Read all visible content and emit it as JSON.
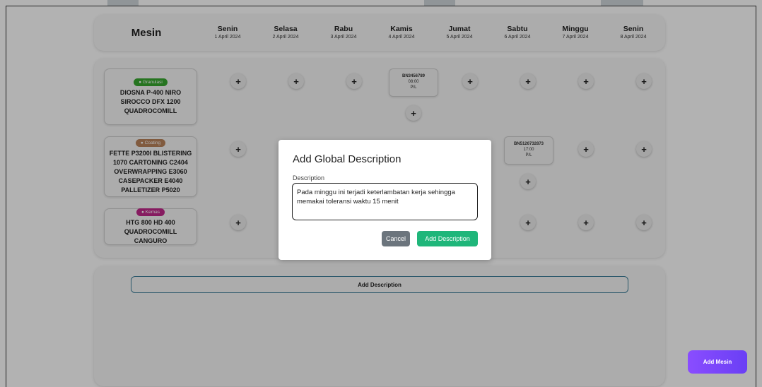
{
  "header": {
    "mesin_label": "Mesin",
    "days": [
      {
        "name": "Senin",
        "date": "1 April 2024"
      },
      {
        "name": "Selasa",
        "date": "2 April 2024"
      },
      {
        "name": "Rabu",
        "date": "3 April 2024"
      },
      {
        "name": "Kamis",
        "date": "4 April 2024"
      },
      {
        "name": "Jumat",
        "date": "5 April 2024"
      },
      {
        "name": "Sabtu",
        "date": "6 April 2024"
      },
      {
        "name": "Minggu",
        "date": "7 April 2024"
      },
      {
        "name": "Senin",
        "date": "8 April 2024"
      }
    ]
  },
  "machines": [
    {
      "category": "Granulasi",
      "category_color": "#37a72e",
      "name": "DIOSNA P-400 NIRO SIROCCO DFX 1200 QUADROCOMILL"
    },
    {
      "category": "Coating",
      "category_color": "#b9835b",
      "name": "FETTE P3200I BLISTERING 1070 CARTONING C2404 OVERWRAPPING E3060 CASEPACKER E4040 PALLETIZER P5020"
    },
    {
      "category": "Kemas",
      "category_color": "#c0278a",
      "name": "HTG 800 HD 400 QUADROCOMILL CANGURO"
    }
  ],
  "batches": [
    {
      "code": "BN3456789",
      "time": "08:00",
      "tag": "P/L"
    },
    {
      "code": "BN5126732873",
      "time": "17:00",
      "tag": "P/L"
    }
  ],
  "plus_symbol": "+",
  "description_section": {
    "add_button_label": "Add Description"
  },
  "add_mesin_label": "Add Mesin",
  "modal": {
    "title": "Add Global Description",
    "label": "Description",
    "value": "Pada minggu ini terjadi keterlambatan kerja sehingga memakai toleransi waktu 15 menit",
    "cancel_label": "Cancel",
    "submit_label": "Add Description"
  },
  "colors": {
    "granulasi": "#37a72e",
    "coating": "#b9835b",
    "kemas": "#c0278a",
    "add_mesin": "#7b45fa",
    "submit": "#1fb67a",
    "cancel": "#6c757d"
  }
}
